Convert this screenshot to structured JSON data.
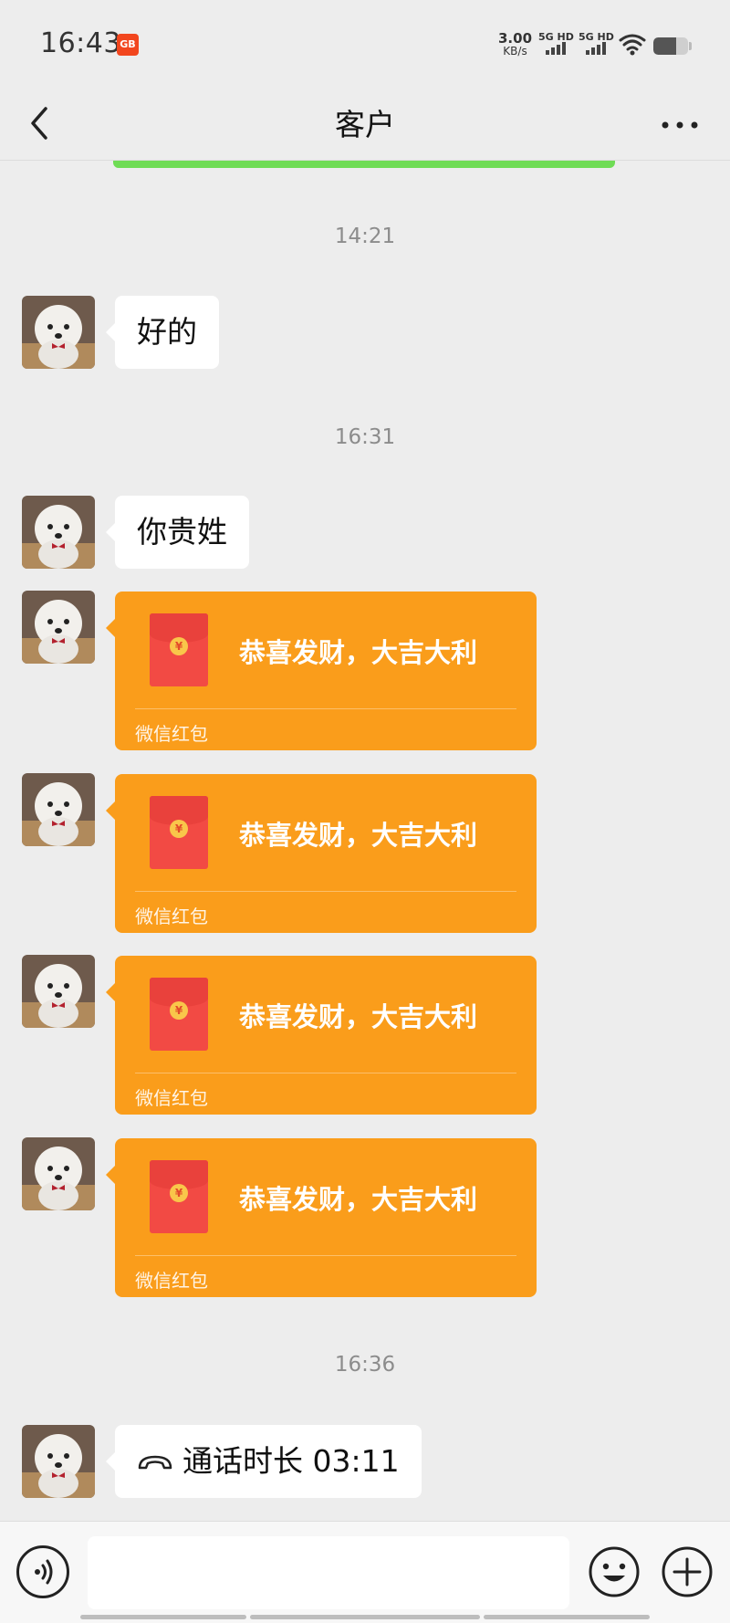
{
  "status_bar": {
    "time": "16:43",
    "app_icon_text": "GB",
    "net_speed_value": "3.00",
    "net_speed_unit": "KB/s",
    "sim1_label": "5G HD",
    "sim2_label": "5G HD",
    "icons": [
      "notification-app-icon",
      "signal-icon",
      "wifi-icon",
      "battery-icon"
    ]
  },
  "header": {
    "title": "客户",
    "icons": [
      "back-icon",
      "more-icon"
    ],
    "accent_color": "#6fdc55"
  },
  "messages": {
    "ts1": "14:21",
    "msg1": "好的",
    "ts2": "16:31",
    "msg2": "你贵姓",
    "red_packets": [
      {
        "title": "恭喜发财，大吉大利",
        "label": "微信红包"
      },
      {
        "title": "恭喜发财，大吉大利",
        "label": "微信红包"
      },
      {
        "title": "恭喜发财，大吉大利",
        "label": "微信红包"
      },
      {
        "title": "恭喜发财，大吉大利",
        "label": "微信红包"
      }
    ],
    "ts3": "16:36",
    "call": "通话时长 03:11",
    "coin_symbol": "¥"
  },
  "input_bar": {
    "message_value": "",
    "icons": [
      "voice-icon",
      "emoji-icon",
      "plus-icon"
    ]
  },
  "colors": {
    "red_packet": "#fa9d1b",
    "envelope": "#f24a44",
    "background": "#ededed"
  }
}
